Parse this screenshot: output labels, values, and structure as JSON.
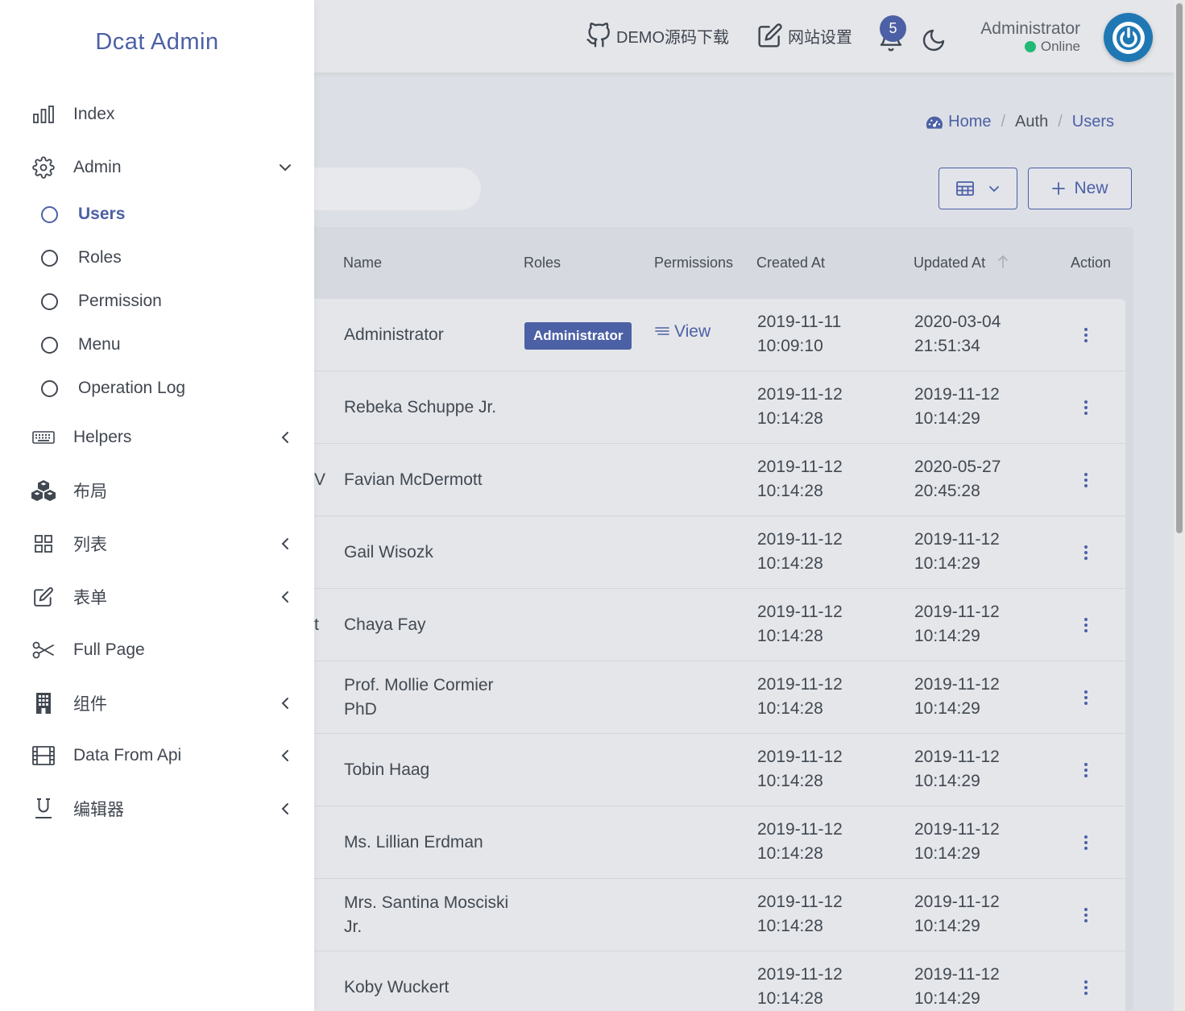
{
  "brand": "Dcat Admin",
  "header": {
    "github_link": "DEMO源码下载",
    "settings_link": "网站设置",
    "notification_count": "5",
    "user_name": "Administrator",
    "user_status": "Online"
  },
  "breadcrumb": [
    "Home",
    "Auth",
    "Users"
  ],
  "toolbar": {
    "new_label": "New"
  },
  "table": {
    "columns": [
      "Name",
      "Roles",
      "Permissions",
      "Created At",
      "Updated At",
      "Action"
    ],
    "rows": [
      {
        "frag": "",
        "name": "Administrator",
        "role": "Administrator",
        "perm": "View",
        "created": "2019-11-11 10:09:10",
        "updated": "2020-03-04 21:51:34"
      },
      {
        "frag": "",
        "name": "Rebeka Schuppe Jr.",
        "role": "",
        "perm": "",
        "created": "2019-11-12 10:14:28",
        "updated": "2019-11-12 10:14:29"
      },
      {
        "frag": "V",
        "name": "Favian McDermott",
        "role": "",
        "perm": "",
        "created": "2019-11-12 10:14:28",
        "updated": "2020-05-27 20:45:28"
      },
      {
        "frag": "",
        "name": "Gail Wisozk",
        "role": "",
        "perm": "",
        "created": "2019-11-12 10:14:28",
        "updated": "2019-11-12 10:14:29"
      },
      {
        "frag": "t",
        "name": "Chaya Fay",
        "role": "",
        "perm": "",
        "created": "2019-11-12 10:14:28",
        "updated": "2019-11-12 10:14:29"
      },
      {
        "frag": "",
        "name": "Prof. Mollie Cormier PhD",
        "role": "",
        "perm": "",
        "created": "2019-11-12 10:14:28",
        "updated": "2019-11-12 10:14:29"
      },
      {
        "frag": "",
        "name": "Tobin Haag",
        "role": "",
        "perm": "",
        "created": "2019-11-12 10:14:28",
        "updated": "2019-11-12 10:14:29"
      },
      {
        "frag": "",
        "name": "Ms. Lillian Erdman",
        "role": "",
        "perm": "",
        "created": "2019-11-12 10:14:28",
        "updated": "2019-11-12 10:14:29"
      },
      {
        "frag": "",
        "name": "Mrs. Santina Mosciski Jr.",
        "role": "",
        "perm": "",
        "created": "2019-11-12 10:14:28",
        "updated": "2019-11-12 10:14:29"
      },
      {
        "frag": "",
        "name": "Koby Wuckert",
        "role": "",
        "perm": "",
        "created": "2019-11-12 10:14:28",
        "updated": "2019-11-12 10:14:29"
      }
    ]
  },
  "sidebar": {
    "items": [
      {
        "label": "Index",
        "icon": "bar-chart-icon"
      },
      {
        "label": "Admin",
        "icon": "gear-icon",
        "caret": "down"
      },
      {
        "label": "Helpers",
        "icon": "keyboard-icon",
        "caret": "left"
      },
      {
        "label": "布局",
        "icon": "cubes-icon"
      },
      {
        "label": "列表",
        "icon": "grid-icon",
        "caret": "left"
      },
      {
        "label": "表单",
        "icon": "edit-icon",
        "caret": "left"
      },
      {
        "label": "Full Page",
        "icon": "scissors-icon"
      },
      {
        "label": "组件",
        "icon": "building-icon",
        "caret": "left"
      },
      {
        "label": "Data From Api",
        "icon": "film-icon",
        "caret": "left"
      },
      {
        "label": "编辑器",
        "icon": "underline-icon",
        "caret": "left"
      }
    ],
    "admin_children": [
      "Users",
      "Roles",
      "Permission",
      "Menu",
      "Operation Log"
    ],
    "active_child": "Users"
  },
  "colors": {
    "accent": "#4c60a5",
    "online": "#21b978",
    "avatar": "#1f78b4"
  }
}
